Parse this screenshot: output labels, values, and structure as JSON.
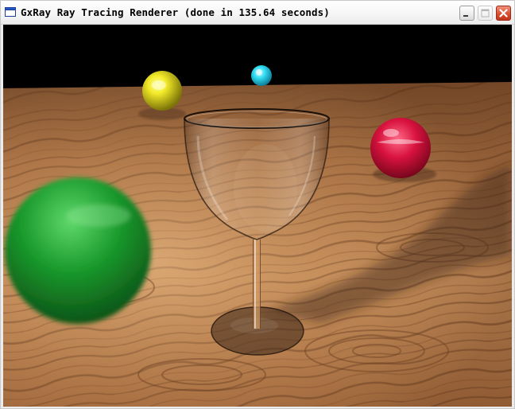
{
  "window": {
    "title": "GxRay Ray Tracing Renderer (done in 135.64 seconds)",
    "icons": {
      "app": "app-window-icon",
      "minimize": "minimize-icon",
      "maximize": "maximize-icon",
      "close": "close-icon"
    }
  },
  "render": {
    "description_icon": "rendered-scene",
    "colors": {
      "background": "#000000",
      "wood_light": "#c9915c",
      "wood_dark": "#6b3f22",
      "sphere_yellow": "#e8e020",
      "sphere_cyan": "#28d8f0",
      "sphere_red": "#d0103a",
      "sphere_green": "#18a030"
    }
  }
}
